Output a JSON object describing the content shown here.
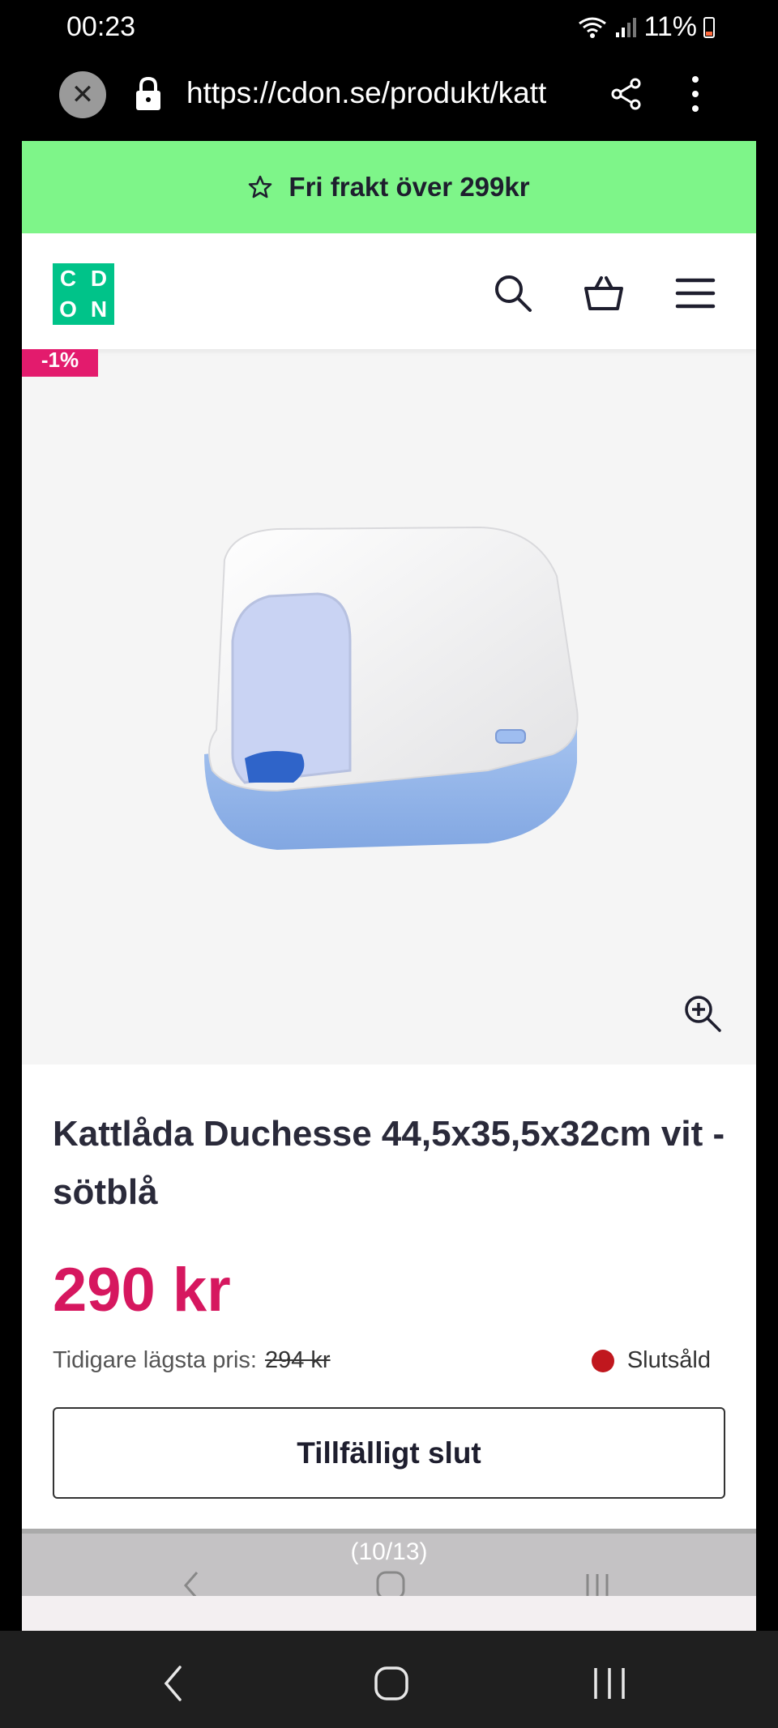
{
  "status_bar": {
    "time": "00:23",
    "battery_text": "11%"
  },
  "browser": {
    "url": "https://cdon.se/produkt/katt"
  },
  "promo": {
    "text": "Fri frakt över 299kr"
  },
  "header": {
    "logo_letters": [
      "C",
      "D",
      "O",
      "N"
    ]
  },
  "product": {
    "discount_badge": "-1%",
    "title": "Kattlåda Duchesse 44,5x35,5x32cm vit - sötblå",
    "price": "290 kr",
    "previous_price_label": "Tidigare lägsta pris:",
    "previous_price_value": "294 kr",
    "stock_status": "Slutsåld",
    "cta_label": "Tillfälligt slut"
  },
  "gallery": {
    "page_counter": "(10/13)"
  },
  "colors": {
    "promo_bg": "#7ef589",
    "brand_green": "#00c389",
    "price_pink": "#d6175f",
    "stock_red": "#c0171e"
  }
}
